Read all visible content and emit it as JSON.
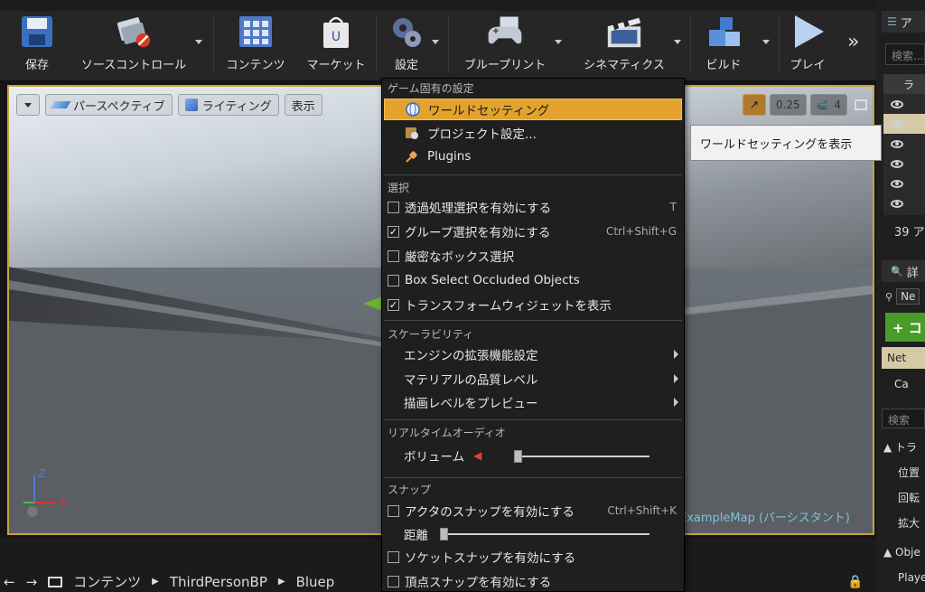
{
  "toolbar": {
    "buttons": [
      {
        "label": "保存",
        "icon": "floppy-disk-icon"
      },
      {
        "label": "ソースコントロール",
        "icon": "source-control-icon"
      },
      {
        "label": "コンテンツ",
        "icon": "content-grid-icon"
      },
      {
        "label": "マーケット",
        "icon": "marketplace-bag-icon"
      },
      {
        "label": "設定",
        "icon": "settings-gears-icon"
      },
      {
        "label": "ブループリント",
        "icon": "blueprint-gamepad-icon"
      },
      {
        "label": "シネマティクス",
        "icon": "clapperboard-icon"
      },
      {
        "label": "ビルド",
        "icon": "build-cubes-icon"
      },
      {
        "label": "プレイ",
        "icon": "play-triangle-icon"
      }
    ],
    "overflow_icon": "double-chevron-right-icon"
  },
  "viewport": {
    "perspective_label": "パースペクティブ",
    "lighting_label": "ライティング",
    "show_label": "表示",
    "scale_value": "0.25",
    "camera_speed": "4",
    "map_label": "ExampleMap (パーシスタント)"
  },
  "menu": {
    "section_game": "ゲーム固有の設定",
    "world_settings": "ワールドセッティング",
    "project_settings": "プロジェクト設定...",
    "plugins": "Plugins",
    "section_select": "選択",
    "translucent_select": "透過処理選択を有効にする",
    "translucent_shortcut": "T",
    "group_select": "グループ選択を有効にする",
    "group_shortcut": "Ctrl+Shift+G",
    "strict_box": "厳密なボックス選択",
    "box_occluded": "Box Select Occluded Objects",
    "show_transform": "トランスフォームウィジェットを表示",
    "section_scalability": "スケーラビリティ",
    "engine_scalability": "エンジンの拡張機能設定",
    "material_quality": "マテリアルの品質レベル",
    "preview_rendering": "描画レベルをプレビュー",
    "section_audio": "リアルタイムオーディオ",
    "volume": "ボリューム",
    "section_snap": "スナップ",
    "actor_snap": "アクタのスナップを有効にする",
    "actor_snap_shortcut": "Ctrl+Shift+K",
    "distance": "距離",
    "socket_snap": "ソケットスナップを有効にする",
    "vertex_snap": "頂点スナップを有効にする",
    "checks": {
      "translucent": false,
      "group": true,
      "strict": false,
      "occluded": false,
      "transform": true,
      "actor_snap": false,
      "socket": false,
      "vertex": false
    },
    "volume_level": 0.0,
    "distance_level": 0.0
  },
  "tooltip": "ワールドセッティングを表示",
  "right_panel": {
    "tab_top": "ア",
    "search_top": "検索...",
    "list_header": "ラ",
    "actor_count": "39 ア",
    "tab_details": "詳",
    "ne_label": "Ne",
    "add_label": "+ コ",
    "net_label": "Net",
    "ca_label": "Ca",
    "search_details": "検索",
    "transform_section": "トラ",
    "position": "位置",
    "rotation": "回転",
    "scale": "拡大",
    "object_section": "Obje",
    "player": "Playe"
  },
  "breadcrumb": {
    "root": "コンテンツ",
    "item1": "ThirdPersonBP",
    "item2": "Bluep"
  }
}
